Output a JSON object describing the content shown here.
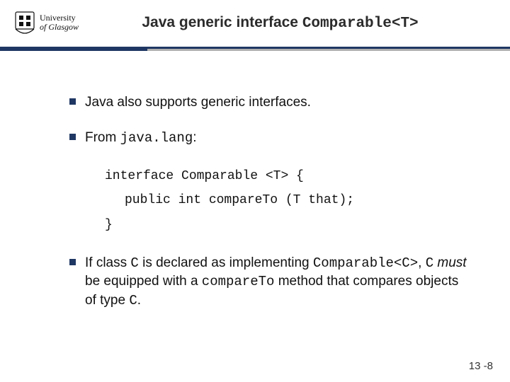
{
  "logo": {
    "line1": "University",
    "line2": "of Glasgow"
  },
  "title": {
    "prefix": "Java generic interface ",
    "code": "Comparable<T>"
  },
  "bullets": {
    "b1": "Java also supports generic interfaces.",
    "b2_prefix": "From ",
    "b2_code": "java.lang",
    "b2_suffix": ":",
    "b3_prefix": "If class ",
    "b3_c1": "C",
    "b3_mid1": " is declared as implementing ",
    "b3_code2": "Comparable<C>",
    "b3_mid2": ", ",
    "b3_c2": "C",
    "b3_must": " must",
    "b3_mid3": " be equipped with a ",
    "b3_code3": "compareTo",
    "b3_mid4": " method that compares objects of type ",
    "b3_c3": "C",
    "b3_end": "."
  },
  "code": {
    "l1": "interface Comparable <T> {",
    "l2": "public int compareTo (T that);",
    "l3": "}"
  },
  "footer": "13 -8"
}
